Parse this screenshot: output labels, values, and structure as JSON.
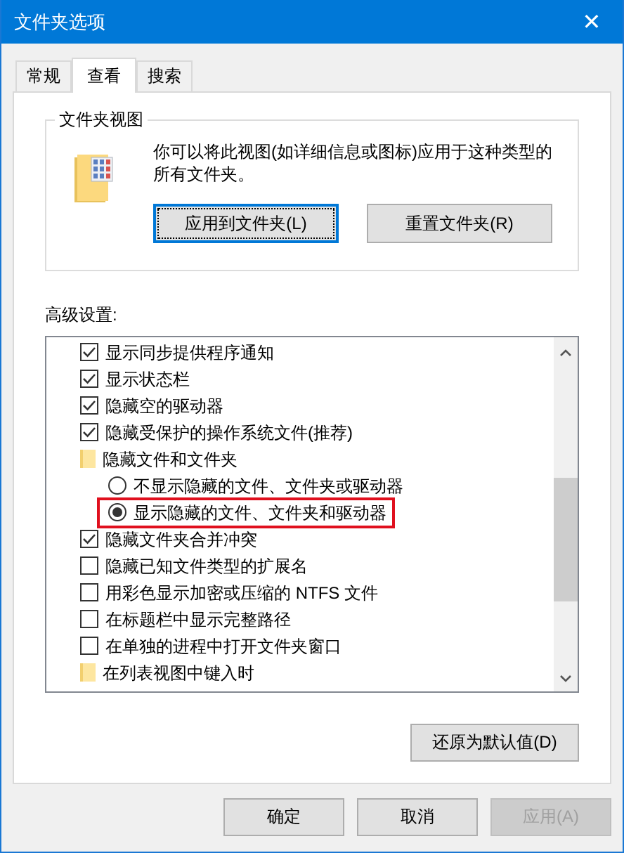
{
  "window": {
    "title": "文件夹选项",
    "close": "✕"
  },
  "tabs": [
    {
      "label": "常规",
      "selected": false
    },
    {
      "label": "查看",
      "selected": true
    },
    {
      "label": "搜索",
      "selected": false
    }
  ],
  "folder_views": {
    "title": "文件夹视图",
    "description": "你可以将此视图(如详细信息或图标)应用于这种类型的所有文件夹。",
    "buttons": [
      {
        "label": "应用到文件夹(L)",
        "focused": true
      },
      {
        "label": "重置文件夹(R)",
        "focused": false
      }
    ]
  },
  "advanced": {
    "label": "高级设置:",
    "items": [
      {
        "kind": "checkbox",
        "label": "显示同步提供程序通知",
        "checked": true
      },
      {
        "kind": "checkbox",
        "label": "显示状态栏",
        "checked": true
      },
      {
        "kind": "checkbox",
        "label": "隐藏空的驱动器",
        "checked": true
      },
      {
        "kind": "checkbox",
        "label": "隐藏受保护的操作系统文件(推荐)",
        "checked": true
      },
      {
        "kind": "folder",
        "label": "隐藏文件和文件夹",
        "children": [
          {
            "kind": "radio",
            "label": "不显示隐藏的文件、文件夹或驱动器",
            "selected": false,
            "highlighted": false
          },
          {
            "kind": "radio",
            "label": "显示隐藏的文件、文件夹和驱动器",
            "selected": true,
            "highlighted": true
          }
        ]
      },
      {
        "kind": "checkbox",
        "label": "隐藏文件夹合并冲突",
        "checked": true
      },
      {
        "kind": "checkbox",
        "label": "隐藏已知文件类型的扩展名",
        "checked": false
      },
      {
        "kind": "checkbox",
        "label": "用彩色显示加密或压缩的 NTFS 文件",
        "checked": false
      },
      {
        "kind": "checkbox",
        "label": "在标题栏中显示完整路径",
        "checked": false
      },
      {
        "kind": "checkbox",
        "label": "在单独的进程中打开文件夹窗口",
        "checked": false
      },
      {
        "kind": "folder",
        "label": "在列表视图中键入时"
      }
    ],
    "restore_button": "还原为默认值(D)"
  },
  "footer_buttons": [
    {
      "label": "确定",
      "disabled": false
    },
    {
      "label": "取消",
      "disabled": false
    },
    {
      "label": "应用(A)",
      "disabled": true
    }
  ]
}
